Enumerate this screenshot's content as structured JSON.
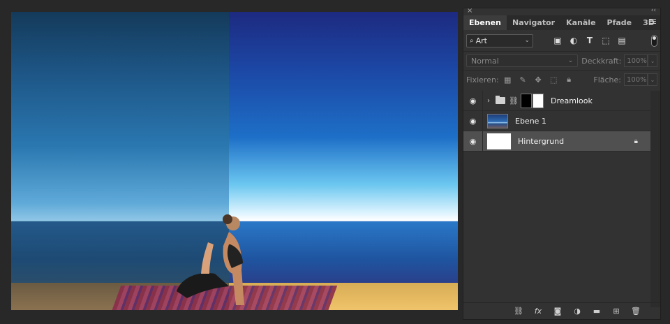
{
  "panel": {
    "close_glyph": "×",
    "collapse_glyph": "‹‹",
    "tabs": [
      {
        "label": "Ebenen",
        "active": true
      },
      {
        "label": "Navigator",
        "active": false
      },
      {
        "label": "Kanäle",
        "active": false
      },
      {
        "label": "Pfade",
        "active": false
      },
      {
        "label": "3D",
        "active": false
      }
    ],
    "filter": {
      "value": "Art",
      "icon": "search-icon"
    },
    "blend_mode": "Normal",
    "opacity_label": "Deckkraft:",
    "opacity_value": "100%",
    "lock_label": "Fixieren:",
    "fill_label": "Fläche:",
    "fill_value": "100%",
    "layers": [
      {
        "name": "Dreamlook",
        "type": "group",
        "visible": true,
        "selected": false,
        "locked": false
      },
      {
        "name": "Ebene 1",
        "type": "image",
        "visible": true,
        "selected": false,
        "locked": false
      },
      {
        "name": "Hintergrund",
        "type": "background",
        "visible": true,
        "selected": true,
        "locked": true
      }
    ],
    "bottom_icons": [
      "link-layers-icon",
      "fx-icon",
      "add-mask-icon",
      "adjustment-layer-icon",
      "new-group-icon",
      "new-layer-icon",
      "delete-layer-icon"
    ]
  },
  "colors": {
    "accent_selected_row": "#505050",
    "panel_bg": "#323232",
    "app_bg": "#282828"
  }
}
